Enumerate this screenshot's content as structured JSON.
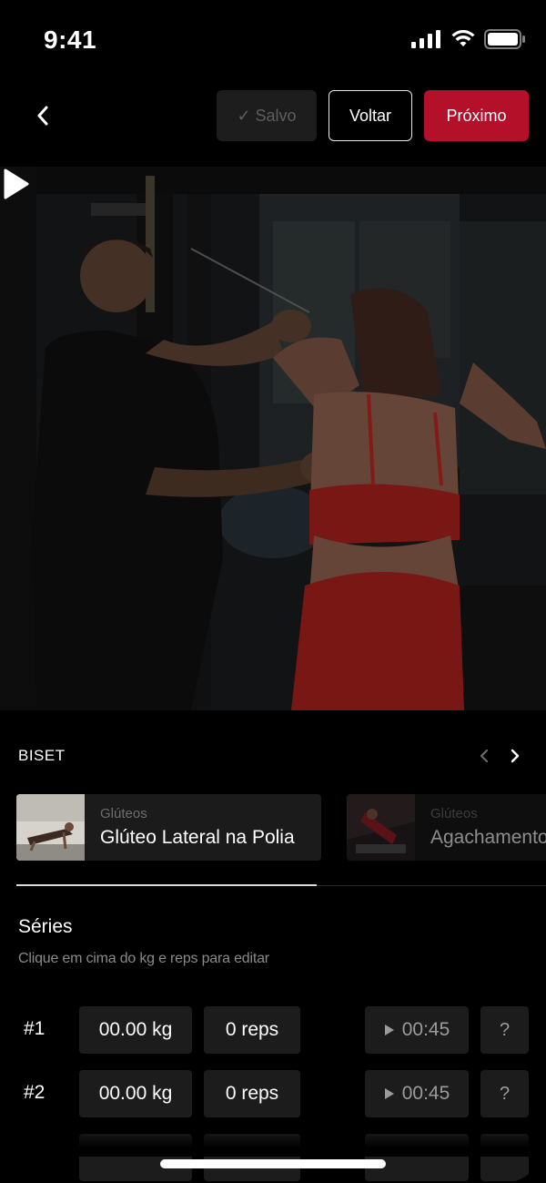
{
  "status": {
    "time": "9:41"
  },
  "header": {
    "saved_label": "✓ Salvo",
    "back_label": "Voltar",
    "next_label": "Próximo"
  },
  "biset": {
    "label": "BISET",
    "exercises": [
      {
        "category": "Glúteos",
        "name": "Glúteo Lateral na Polia"
      },
      {
        "category": "Glúteos",
        "name": "Agachamento"
      }
    ]
  },
  "series": {
    "title": "Séries",
    "hint": "Clique em cima do kg e reps para editar",
    "rows": [
      {
        "num": "#1",
        "kg": "00.00 kg",
        "reps": "0 reps",
        "timer": "00:45",
        "help": "?"
      },
      {
        "num": "#2",
        "kg": "00.00 kg",
        "reps": "0 reps",
        "timer": "00:45",
        "help": "?"
      }
    ]
  },
  "colors": {
    "accent": "#b5102a",
    "background": "#000000",
    "card": "#1c1c1c"
  },
  "icons": [
    "back-chevron-icon",
    "signal-icon",
    "wifi-icon",
    "battery-icon",
    "play-icon",
    "chevron-left-icon",
    "chevron-right-icon"
  ]
}
